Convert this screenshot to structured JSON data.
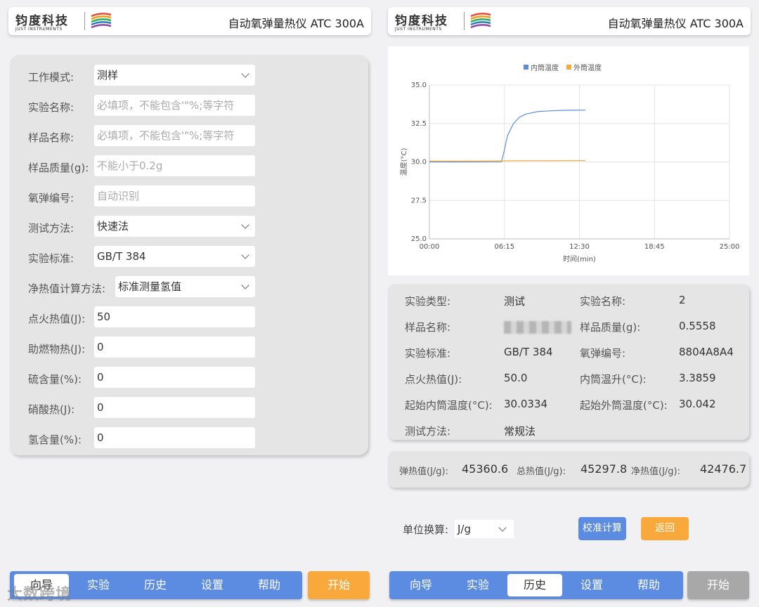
{
  "header": {
    "logo_cn": "钧度科技",
    "logo_en": "JUST INSTRUMENTS",
    "title": "自动氧弹量热仪 ATC 300A"
  },
  "form": {
    "rows": [
      {
        "label": "工作模式:",
        "value": "测样",
        "placeholder": "",
        "type": "select"
      },
      {
        "label": "实验名称:",
        "value": "",
        "placeholder": "必填项，不能包含'\"%;等字符",
        "type": "input"
      },
      {
        "label": "样品名称:",
        "value": "",
        "placeholder": "必填项，不能包含'\"%;等字符",
        "type": "input"
      },
      {
        "label": "样品质量(g):",
        "value": "",
        "placeholder": "不能小于0.2g",
        "type": "input"
      },
      {
        "label": "氧弹编号:",
        "value": "",
        "placeholder": "自动识别",
        "type": "input"
      },
      {
        "label": "测试方法:",
        "value": "快速法",
        "placeholder": "",
        "type": "select"
      },
      {
        "label": "实验标准:",
        "value": "GB/T 384",
        "placeholder": "",
        "type": "select"
      },
      {
        "label": "净热值计算方法:",
        "value": "标准测量氢值",
        "placeholder": "",
        "type": "select"
      },
      {
        "label": "点火热值(J):",
        "value": "50",
        "placeholder": "",
        "type": "input"
      },
      {
        "label": "助燃物热(J):",
        "value": "0",
        "placeholder": "",
        "type": "input"
      },
      {
        "label": "硫含量(%):",
        "value": "0",
        "placeholder": "",
        "type": "input"
      },
      {
        "label": "硝酸热(J):",
        "value": "0",
        "placeholder": "",
        "type": "input"
      },
      {
        "label": "氢含量(%):",
        "value": "0",
        "placeholder": "",
        "type": "input"
      }
    ]
  },
  "nav_left": {
    "items": [
      "向导",
      "实验",
      "历史",
      "设置",
      "帮助"
    ],
    "active": "向导",
    "start_label": "开始",
    "start_color": "#f9a93b"
  },
  "nav_right": {
    "items": [
      "向导",
      "实验",
      "历史",
      "设置",
      "帮助"
    ],
    "active": "历史",
    "start_label": "开始",
    "start_color": "#a8a8a8"
  },
  "watermark": "大数跨境",
  "chart_data": {
    "type": "line",
    "series": [
      {
        "name": "内筒温度",
        "color": "#5b8ce2",
        "x": [
          0,
          2,
          4,
          6,
          6.2,
          6.5,
          7,
          7.5,
          8,
          9,
          10,
          11,
          12,
          13
        ],
        "values": [
          30.0,
          30.0,
          30.0,
          30.01,
          30.6,
          31.7,
          32.5,
          32.9,
          33.1,
          33.27,
          33.32,
          33.35,
          33.36,
          33.37
        ]
      },
      {
        "name": "外筒温度",
        "color": "#f9a93b",
        "x": [
          0,
          2,
          4,
          6,
          8,
          10,
          12,
          13
        ],
        "values": [
          30.05,
          30.05,
          30.06,
          30.07,
          30.08,
          30.08,
          30.09,
          30.09
        ]
      }
    ],
    "x_ticks": [
      "00:00",
      "06:15",
      "12:30",
      "18:45",
      "25:00"
    ],
    "y_ticks": [
      "25.0",
      "27.5",
      "30.0",
      "32.5",
      "35.0"
    ],
    "xlabel": "时间(min)",
    "ylabel": "温度(°C)",
    "xlim": [
      0,
      25
    ],
    "ylim": [
      25,
      35
    ],
    "legend": "top-center",
    "grid": true
  },
  "info": {
    "rows": [
      [
        {
          "label": "实验类型:",
          "value": "测试"
        },
        {
          "label": "实验名称:",
          "value": "2"
        }
      ],
      [
        {
          "label": "样品名称:",
          "value": ""
        },
        {
          "label": "样品质量(g):",
          "value": "0.5558"
        }
      ],
      [
        {
          "label": "实验标准:",
          "value": "GB/T 384"
        },
        {
          "label": "氧弹编号:",
          "value": "8804A8A4"
        }
      ],
      [
        {
          "label": "点火热值(J):",
          "value": "50.0"
        },
        {
          "label": "内筒温升(°C):",
          "value": "3.3859"
        }
      ],
      [
        {
          "label": "起始内筒温度(°C):",
          "value": "30.0334"
        },
        {
          "label": "起始外筒温度(°C):",
          "value": "30.042"
        }
      ],
      [
        {
          "label": "测试方法:",
          "value": "常规法"
        }
      ]
    ]
  },
  "heat": {
    "bomb_label": "弹热值(J/g):",
    "bomb_value": "45360.6",
    "gross_label": "总热值(J/g):",
    "gross_value": "45297.8",
    "net_label": "净热值(J/g):",
    "net_value": "42476.7"
  },
  "unit": {
    "label": "单位换算:",
    "value": "J/g",
    "calibrate_label": "校准计算",
    "back_label": "返回"
  },
  "colors": {
    "accent": "#5b8ce2",
    "orange": "#f9a93b",
    "card_bg": "#e5e5e5"
  }
}
